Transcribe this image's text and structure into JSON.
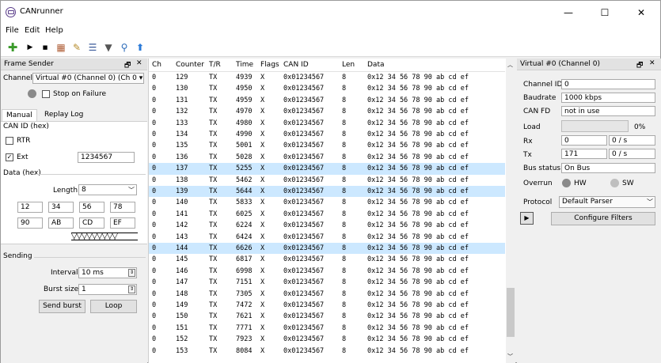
{
  "window": {
    "title": "CANrunner",
    "min": "—",
    "max": "☐",
    "close": "✕"
  },
  "menu": [
    "File",
    "Edit",
    "Help"
  ],
  "toolbar_icons": [
    "add-icon",
    "play-icon",
    "stop-icon",
    "save-icon",
    "edit-icon",
    "tree-icon",
    "filter-icon",
    "search-icon",
    "up-arrow-icon"
  ],
  "frame_sender": {
    "title": "Frame Sender",
    "float": "🗗",
    "close": "✕",
    "channel_label": "Channel",
    "channel_value": "Virtual #0 (Channel 0) (Ch 0 ▾",
    "stop_on_failure": "Stop on Failure",
    "tabs": [
      "Manual",
      "Replay Log"
    ],
    "can_id_hex": "CAN ID (hex)",
    "rtr": "RTR",
    "ext": "Ext",
    "ext_checked": "✓",
    "can_id_value": "1234567",
    "data_hex": "Data (hex)",
    "length_label": "Length",
    "length_value": "8",
    "bytes": [
      "12",
      "34",
      "56",
      "78",
      "90",
      "AB",
      "CD",
      "EF"
    ],
    "sending": "Sending",
    "interval_label": "Interval",
    "interval_value": "10 ms",
    "burst_label": "Burst size",
    "burst_value": "1",
    "send_burst": "Send burst",
    "loop": "Loop"
  },
  "table": {
    "headers": [
      "Ch",
      "Counter",
      "T/R",
      "Time",
      "Flags",
      "CAN ID",
      "Len",
      "Data"
    ],
    "rows": [
      {
        "ch": "0",
        "counter": "129",
        "tr": "TX",
        "time": "4939",
        "flags": "X",
        "id": "0x01234567",
        "len": "8",
        "data": "0x12 34 56 78 90 ab cd ef",
        "sel": false
      },
      {
        "ch": "0",
        "counter": "130",
        "tr": "TX",
        "time": "4950",
        "flags": "X",
        "id": "0x01234567",
        "len": "8",
        "data": "0x12 34 56 78 90 ab cd ef",
        "sel": false
      },
      {
        "ch": "0",
        "counter": "131",
        "tr": "TX",
        "time": "4959",
        "flags": "X",
        "id": "0x01234567",
        "len": "8",
        "data": "0x12 34 56 78 90 ab cd ef",
        "sel": false
      },
      {
        "ch": "0",
        "counter": "132",
        "tr": "TX",
        "time": "4970",
        "flags": "X",
        "id": "0x01234567",
        "len": "8",
        "data": "0x12 34 56 78 90 ab cd ef",
        "sel": false
      },
      {
        "ch": "0",
        "counter": "133",
        "tr": "TX",
        "time": "4980",
        "flags": "X",
        "id": "0x01234567",
        "len": "8",
        "data": "0x12 34 56 78 90 ab cd ef",
        "sel": false
      },
      {
        "ch": "0",
        "counter": "134",
        "tr": "TX",
        "time": "4990",
        "flags": "X",
        "id": "0x01234567",
        "len": "8",
        "data": "0x12 34 56 78 90 ab cd ef",
        "sel": false
      },
      {
        "ch": "0",
        "counter": "135",
        "tr": "TX",
        "time": "5001",
        "flags": "X",
        "id": "0x01234567",
        "len": "8",
        "data": "0x12 34 56 78 90 ab cd ef",
        "sel": false
      },
      {
        "ch": "0",
        "counter": "136",
        "tr": "TX",
        "time": "5028",
        "flags": "X",
        "id": "0x01234567",
        "len": "8",
        "data": "0x12 34 56 78 90 ab cd ef",
        "sel": false
      },
      {
        "ch": "0",
        "counter": "137",
        "tr": "TX",
        "time": "5255",
        "flags": "X",
        "id": "0x01234567",
        "len": "8",
        "data": "0x12 34 56 78 90 ab cd ef",
        "sel": true
      },
      {
        "ch": "0",
        "counter": "138",
        "tr": "TX",
        "time": "5462",
        "flags": "X",
        "id": "0x01234567",
        "len": "8",
        "data": "0x12 34 56 78 90 ab cd ef",
        "sel": false
      },
      {
        "ch": "0",
        "counter": "139",
        "tr": "TX",
        "time": "5644",
        "flags": "X",
        "id": "0x01234567",
        "len": "8",
        "data": "0x12 34 56 78 90 ab cd ef",
        "sel": true
      },
      {
        "ch": "0",
        "counter": "140",
        "tr": "TX",
        "time": "5833",
        "flags": "X",
        "id": "0x01234567",
        "len": "8",
        "data": "0x12 34 56 78 90 ab cd ef",
        "sel": false
      },
      {
        "ch": "0",
        "counter": "141",
        "tr": "TX",
        "time": "6025",
        "flags": "X",
        "id": "0x01234567",
        "len": "8",
        "data": "0x12 34 56 78 90 ab cd ef",
        "sel": false
      },
      {
        "ch": "0",
        "counter": "142",
        "tr": "TX",
        "time": "6224",
        "flags": "X",
        "id": "0x01234567",
        "len": "8",
        "data": "0x12 34 56 78 90 ab cd ef",
        "sel": false
      },
      {
        "ch": "0",
        "counter": "143",
        "tr": "TX",
        "time": "6424",
        "flags": "X",
        "id": "0x01234567",
        "len": "8",
        "data": "0x12 34 56 78 90 ab cd ef",
        "sel": false
      },
      {
        "ch": "0",
        "counter": "144",
        "tr": "TX",
        "time": "6626",
        "flags": "X",
        "id": "0x01234567",
        "len": "8",
        "data": "0x12 34 56 78 90 ab cd ef",
        "sel": true
      },
      {
        "ch": "0",
        "counter": "145",
        "tr": "TX",
        "time": "6817",
        "flags": "X",
        "id": "0x01234567",
        "len": "8",
        "data": "0x12 34 56 78 90 ab cd ef",
        "sel": false
      },
      {
        "ch": "0",
        "counter": "146",
        "tr": "TX",
        "time": "6998",
        "flags": "X",
        "id": "0x01234567",
        "len": "8",
        "data": "0x12 34 56 78 90 ab cd ef",
        "sel": false
      },
      {
        "ch": "0",
        "counter": "147",
        "tr": "TX",
        "time": "7151",
        "flags": "X",
        "id": "0x01234567",
        "len": "8",
        "data": "0x12 34 56 78 90 ab cd ef",
        "sel": false
      },
      {
        "ch": "0",
        "counter": "148",
        "tr": "TX",
        "time": "7305",
        "flags": "X",
        "id": "0x01234567",
        "len": "8",
        "data": "0x12 34 56 78 90 ab cd ef",
        "sel": false
      },
      {
        "ch": "0",
        "counter": "149",
        "tr": "TX",
        "time": "7472",
        "flags": "X",
        "id": "0x01234567",
        "len": "8",
        "data": "0x12 34 56 78 90 ab cd ef",
        "sel": false
      },
      {
        "ch": "0",
        "counter": "150",
        "tr": "TX",
        "time": "7621",
        "flags": "X",
        "id": "0x01234567",
        "len": "8",
        "data": "0x12 34 56 78 90 ab cd ef",
        "sel": false
      },
      {
        "ch": "0",
        "counter": "151",
        "tr": "TX",
        "time": "7771",
        "flags": "X",
        "id": "0x01234567",
        "len": "8",
        "data": "0x12 34 56 78 90 ab cd ef",
        "sel": false
      },
      {
        "ch": "0",
        "counter": "152",
        "tr": "TX",
        "time": "7923",
        "flags": "X",
        "id": "0x01234567",
        "len": "8",
        "data": "0x12 34 56 78 90 ab cd ef",
        "sel": false
      },
      {
        "ch": "0",
        "counter": "153",
        "tr": "TX",
        "time": "8084",
        "flags": "X",
        "id": "0x01234567",
        "len": "8",
        "data": "0x12 34 56 78 90 ab cd ef",
        "sel": false
      }
    ]
  },
  "channel_panel": {
    "title": "Virtual #0 (Channel 0)",
    "float": "🗗",
    "close": "✕",
    "channel_id_label": "Channel ID",
    "channel_id": "0",
    "baudrate_label": "Baudrate",
    "baudrate": "1000 kbps",
    "canfd_label": "CAN FD",
    "canfd": "not in use",
    "load_label": "Load",
    "load": "0%",
    "rx_label": "Rx",
    "rx_count": "0",
    "rx_rate": "0 / s",
    "tx_label": "Tx",
    "tx_count": "171",
    "tx_rate": "0 / s",
    "bus_status_label": "Bus status",
    "bus_status": "On Bus",
    "overrun_label": "Overrun",
    "hw": "HW",
    "sw": "SW",
    "protocol_label": "Protocol",
    "protocol": "Default Parser",
    "configure_filters": "Configure Filters"
  }
}
